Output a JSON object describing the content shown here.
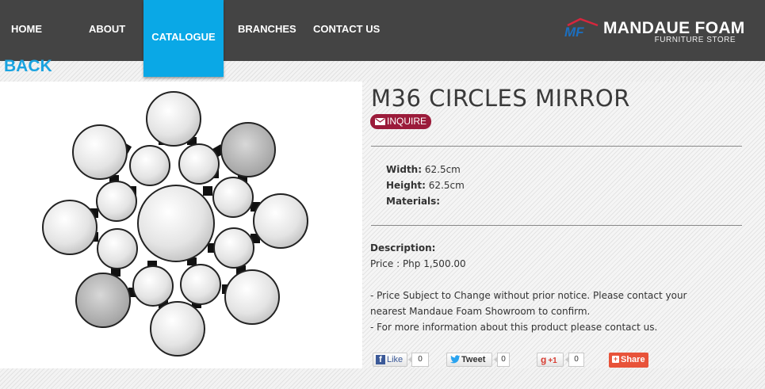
{
  "nav": {
    "items": [
      "HOME",
      "ABOUT",
      "CATALOGUE",
      "BRANCHES",
      "CONTACT US"
    ],
    "active": "CATALOGUE"
  },
  "logo": {
    "mark": "MF",
    "title": "MANDAUE FOAM",
    "subtitle": "FURNITURE STORE"
  },
  "back_label": "BACK",
  "product": {
    "title": "M36 CIRCLES MIRROR",
    "inquire_label": "INQUIRE",
    "specs": {
      "width_label": "Width:",
      "width_value": "62.5cm",
      "height_label": "Height:",
      "height_value": "62.5cm",
      "materials_label": "Materials:",
      "materials_value": ""
    },
    "description_label": "Description:",
    "price_line": "Price : Php 1,500.00",
    "notes": [
      "- Price Subject to Change without prior notice. Please contact your",
      "nearest Mandaue Foam Showroom to confirm.",
      "- For more information about this product please contact us."
    ]
  },
  "social": {
    "like_label": "Like",
    "like_count": "0",
    "tweet_label": "Tweet",
    "tweet_count": "0",
    "plusone_label": "+1",
    "plusone_count": "0",
    "share_label": "Share"
  },
  "colors": {
    "topbar": "#444444",
    "nav_active": "#0aa8e6",
    "back_link": "#1aa3e0",
    "inquire": "#9b1b3a",
    "share": "#e8533a"
  }
}
